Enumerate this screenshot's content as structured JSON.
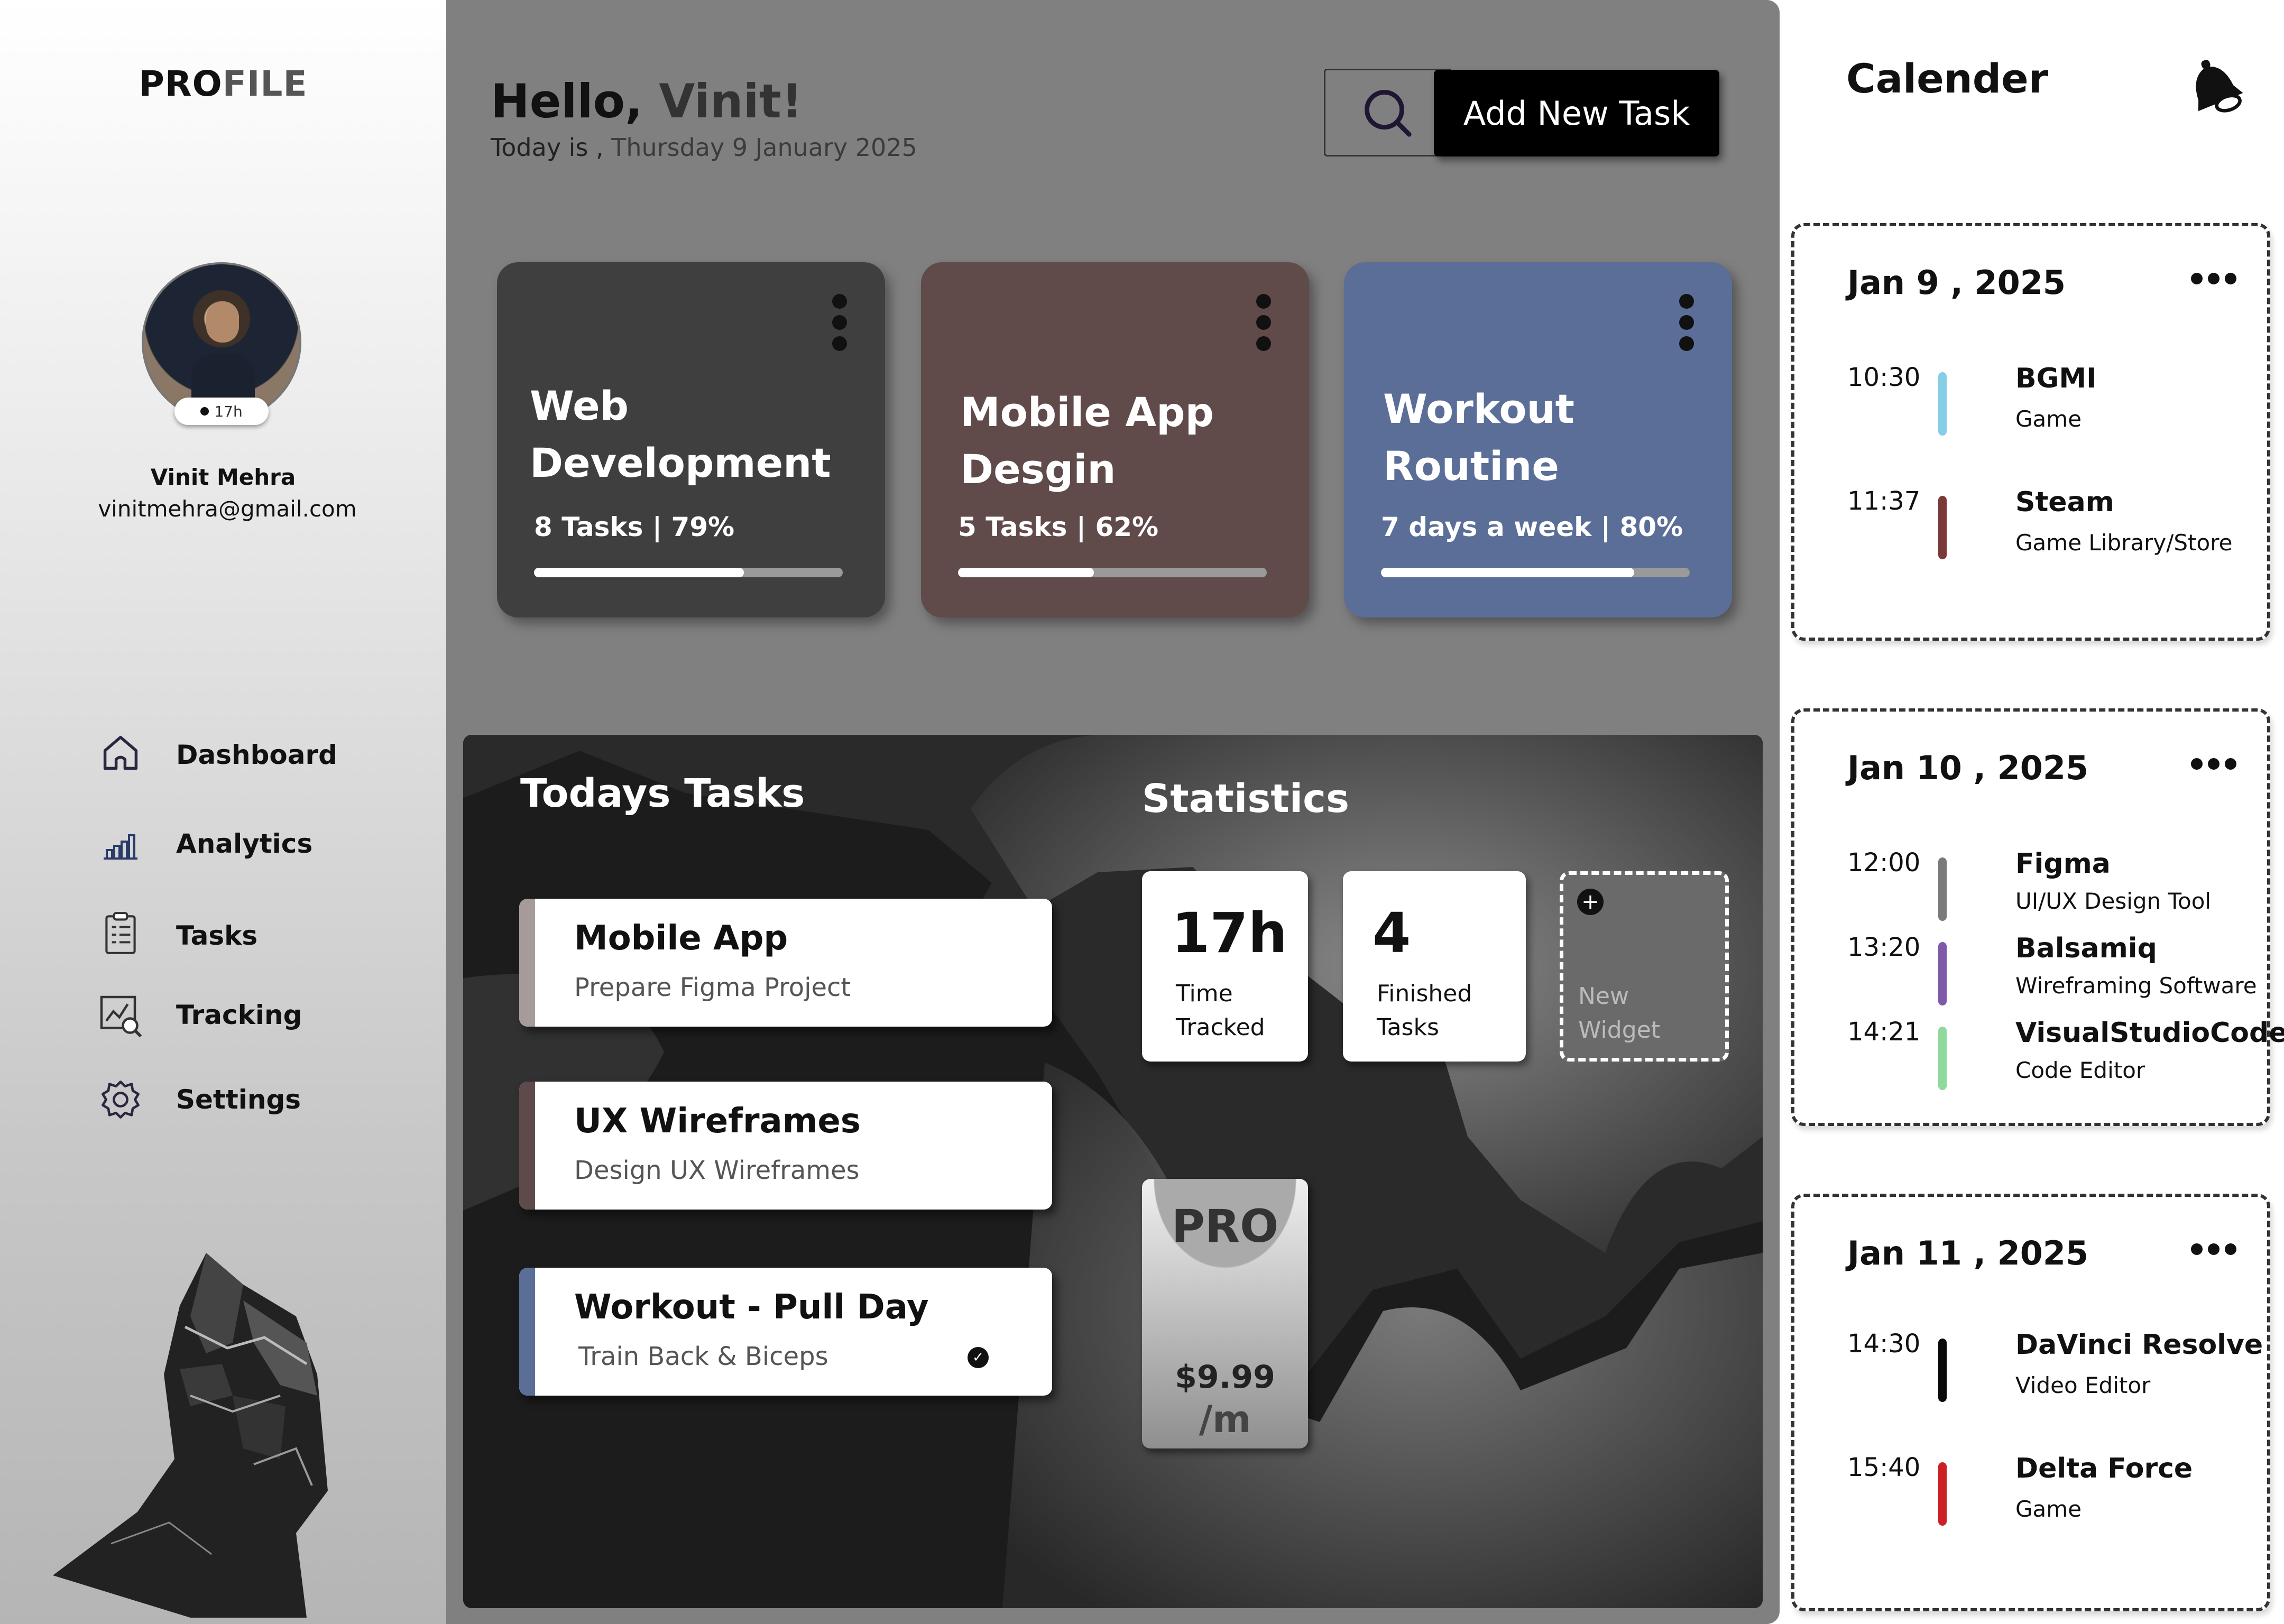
{
  "sidebar": {
    "heading_part1": "PRO",
    "heading_part2": "FILE",
    "avatar_status": "17h",
    "user_name": "Vinit Mehra",
    "user_email": "vinitmehra@gmail.com",
    "nav": [
      {
        "label": "Dashboard",
        "icon": "home-icon"
      },
      {
        "label": "Analytics",
        "icon": "bar-chart-icon"
      },
      {
        "label": "Tasks",
        "icon": "clipboard-icon"
      },
      {
        "label": "Tracking",
        "icon": "tracking-icon"
      },
      {
        "label": "Settings",
        "icon": "gear-icon"
      }
    ]
  },
  "header": {
    "greeting_prefix": "Hello, ",
    "greeting_name": "Vinit!",
    "today_prefix": "Today is , ",
    "today_date": "Thursday 9 January 2025",
    "add_task_label": "Add New Task"
  },
  "projects": [
    {
      "title": "Web Development",
      "meta": "8 Tasks | 79%",
      "progress": 0.68,
      "color": "#3f3f3f"
    },
    {
      "title": "Mobile App Desgin",
      "meta": "5 Tasks | 62%",
      "progress": 0.44,
      "color": "#614a4a"
    },
    {
      "title": "Workout Routine",
      "meta": "7 days a week | 80%",
      "progress": 0.82,
      "color": "#5b6e98"
    }
  ],
  "todays_tasks": {
    "heading": "Todays Tasks",
    "items": [
      {
        "title": "Mobile App",
        "subtitle": "Prepare Figma Project",
        "color": "#a79b99"
      },
      {
        "title": "UX Wireframes",
        "subtitle": "Design UX Wireframes",
        "color": "#5e4a4a"
      },
      {
        "title": "Workout - Pull Day",
        "subtitle": "Train Back & Biceps",
        "color": "#5b6e98",
        "done": true
      }
    ]
  },
  "statistics": {
    "heading": "Statistics",
    "time_value": "17h",
    "time_label_1": "Time",
    "time_label_2": "Tracked",
    "finished_value": "4",
    "finished_label_1": "Finished",
    "finished_label_2": "Tasks",
    "widget_label_1": "New",
    "widget_label_2": "Widget",
    "pro_label": "PRO",
    "pro_price": "$9.99",
    "pro_period": "/m"
  },
  "calendar": {
    "title": "Calender",
    "days": [
      {
        "date": "Jan 9 , 2025",
        "events": [
          {
            "time": "10:30",
            "name": "BGMI",
            "sub": "Game",
            "color": "#86cde6"
          },
          {
            "time": "11:37",
            "name": "Steam",
            "sub": "Game Library/Store",
            "color": "#7a3a3a"
          }
        ]
      },
      {
        "date": "Jan 10 , 2025",
        "events": [
          {
            "time": "12:00",
            "name": "Figma",
            "sub": "UI/UX Design Tool",
            "color": "#7a7a7a"
          },
          {
            "time": "13:20",
            "name": "Balsamiq",
            "sub": "Wireframing Software",
            "color": "#7f5aa8"
          },
          {
            "time": "14:21",
            "name": "VisualStudioCode",
            "sub": "Code Editor",
            "color": "#8ed99b"
          }
        ]
      },
      {
        "date": "Jan 11 , 2025",
        "events": [
          {
            "time": "14:30",
            "name": "DaVinci Resolve",
            "sub": "Video Editor",
            "color": "#0a0a0a"
          },
          {
            "time": "15:40",
            "name": "Delta Force",
            "sub": "Game",
            "color": "#cc1f26"
          }
        ]
      }
    ]
  }
}
